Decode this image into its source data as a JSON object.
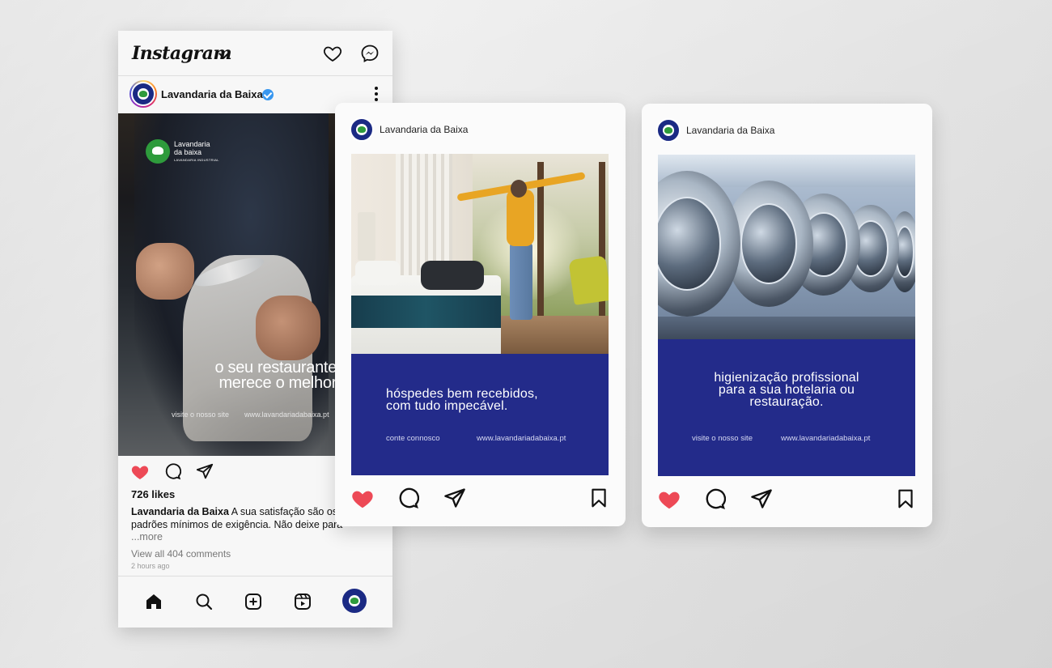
{
  "phone": {
    "app_title": "Instagram",
    "account_name": "Lavandaria da Baixa",
    "post_image": {
      "logo_line1": "Lavandaria",
      "logo_line2": "da baixa",
      "logo_line3": "LAVANDARIA INDUSTRIAL",
      "headline_line1": "o seu restaurante",
      "headline_line2": "merece o melhor",
      "link_label": "visite o nosso site",
      "link_url": "www.lavandariadabaixa.pt"
    },
    "likes": "726 likes",
    "caption_author": "Lavandaria da Baixa",
    "caption_text": "A sua satisfação são os padrões mínimos de exigência. Não deixe para",
    "caption_more": "...more",
    "view_comments": "View all 404 comments",
    "time_ago": "2 hours ago"
  },
  "card1": {
    "account_name": "Lavandaria da Baixa",
    "headline_line1": "hóspedes bem recebidos,",
    "headline_line2": "com tudo impecável.",
    "link_label": "conte connosco",
    "link_url": "www.lavandariadabaixa.pt"
  },
  "card2": {
    "account_name": "Lavandaria da Baixa",
    "headline_line1": "higienização profissional",
    "headline_line2": "para a sua hotelaria ou",
    "headline_line3": "restauração.",
    "link_label": "visite o nosso site",
    "link_url": "www.lavandariadabaixa.pt"
  },
  "colors": {
    "brand_blue": "#232b8a",
    "brand_green": "#2e9b3c",
    "like_red": "#ed4956",
    "verified_blue": "#3897f0"
  },
  "icons": [
    "heart-icon",
    "messenger-icon",
    "comment-icon",
    "share-icon",
    "bookmark-icon",
    "home-icon",
    "search-icon",
    "add-icon",
    "reels-icon",
    "more-options-icon",
    "verified-icon"
  ]
}
